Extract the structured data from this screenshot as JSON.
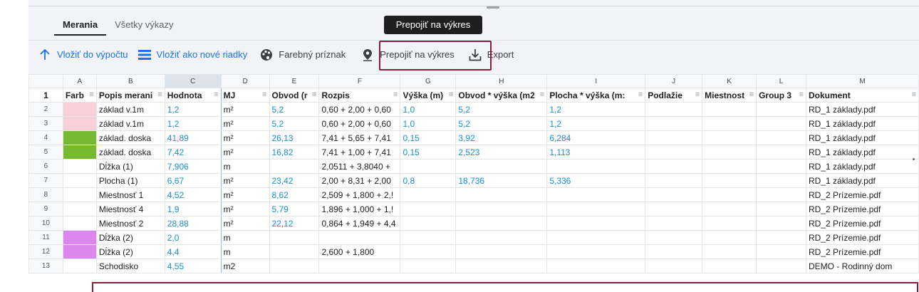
{
  "tabs": [
    "Merania",
    "Všetky výkazy"
  ],
  "tooltip": "Prepojiť na výkres",
  "toolbar": {
    "insert_calc": "Vložiť do výpočtu",
    "insert_rows": "Vložiť ako nové riadky",
    "color_flag": "Farebný príznak",
    "link_drawing": "Prepojiť na výkres",
    "export": "Export"
  },
  "colors": {
    "accent": "#1a73e8",
    "highlight": "#8e1b3b",
    "pink": "#f8d0da",
    "green": "#76b830",
    "violet": "#dc86f0"
  },
  "columns": [
    "A",
    "B",
    "C",
    "D",
    "E",
    "F",
    "G",
    "H",
    "I",
    "J",
    "K",
    "L",
    "M"
  ],
  "headers": [
    "Farb",
    "Popis merani",
    "Hodnota",
    "MJ",
    "Obvod (r",
    "Rozpis",
    "Výška (m)",
    "Obvod * výška (m2",
    "Plocha * výška (m:",
    "Podlažie",
    "Miestnost",
    "Group 3",
    "Dokument"
  ],
  "rows": [
    {
      "n": "2",
      "color": "pink",
      "popis": "základ v.1m",
      "hodnota": "1,2",
      "mj": "m²",
      "obvod": "5,2",
      "rozpis": "0,60 + 2,00 + 0,60",
      "vyska": "1,0",
      "ov": "5,2",
      "pv": "1,2",
      "dok": "RD_1 základy.pdf"
    },
    {
      "n": "3",
      "color": "pink",
      "popis": "základ v.1m",
      "hodnota": "1,2",
      "mj": "m²",
      "obvod": "5,2",
      "rozpis": "0,60 + 2,00 + 0,60",
      "vyska": "1,0",
      "ov": "5,2",
      "pv": "1,2",
      "dok": "RD_1 základy.pdf"
    },
    {
      "n": "4",
      "color": "green",
      "popis": "základ. doska",
      "hodnota": "41,89",
      "mj": "m²",
      "obvod": "26,13",
      "rozpis": "7,41 + 5,65 + 7,41",
      "vyska": "0,15",
      "ov": "3,92",
      "pv": "6,284",
      "dok": "RD_1 základy.pdf"
    },
    {
      "n": "5",
      "color": "green",
      "popis": "základ. doska",
      "hodnota": "7,42",
      "mj": "m²",
      "obvod": "16,82",
      "rozpis": "7,41 + 1,00 + 7,41",
      "vyska": "0,15",
      "ov": "2,523",
      "pv": "1,113",
      "dok": "RD_1 základy.pdf"
    },
    {
      "n": "6",
      "color": "",
      "popis": "Dĺžka (1)",
      "hodnota": "7,906",
      "mj": "m",
      "obvod": "",
      "rozpis": "2,0511 + 3,8040 +",
      "vyska": "",
      "ov": "",
      "pv": "",
      "dok": "RD_1 základy.pdf"
    },
    {
      "n": "7",
      "color": "",
      "popis": "Plocha (1)",
      "hodnota": "6,67",
      "mj": "m²",
      "obvod": "23,42",
      "rozpis": "2,00 + 8,31 + 2,00",
      "vyska": "0,8",
      "ov": "18,736",
      "pv": "5,336",
      "dok": "RD_1 základy.pdf"
    },
    {
      "n": "8",
      "color": "",
      "popis": "Miestnosť 1",
      "hodnota": "4,52",
      "mj": "m²",
      "obvod": "8,62",
      "rozpis": "2,509 + 1,800 + 2,!",
      "vyska": "",
      "ov": "",
      "pv": "",
      "dok": "RD_2 Prízemie.pdf"
    },
    {
      "n": "9",
      "color": "",
      "popis": "Miestnosť 4",
      "hodnota": "1,9",
      "mj": "m²",
      "obvod": "5,79",
      "rozpis": "1,896 + 1,000 + 1,!",
      "vyska": "",
      "ov": "",
      "pv": "",
      "dok": "RD_2 Prízemie.pdf"
    },
    {
      "n": "10",
      "color": "",
      "popis": "Miestnosť 2",
      "hodnota": "28,88",
      "mj": "m²",
      "obvod": "22,12",
      "rozpis": "0,864 + 1,949 + 4,4",
      "vyska": "",
      "ov": "",
      "pv": "",
      "dok": "RD_2 Prízemie.pdf"
    },
    {
      "n": "11",
      "color": "violet",
      "popis": "Dĺžka (2)",
      "hodnota": "2,0",
      "mj": "m",
      "obvod": "",
      "rozpis": "",
      "vyska": "",
      "ov": "",
      "pv": "",
      "dok": "RD_2 Prízemie.pdf"
    },
    {
      "n": "12",
      "color": "violet",
      "popis": "Dĺžka (2)",
      "hodnota": "4,4",
      "mj": "m",
      "obvod": "",
      "rozpis": "2,600 + 1,800",
      "vyska": "",
      "ov": "",
      "pv": "",
      "dok": "RD_2 Prízemie.pdf"
    },
    {
      "n": "13",
      "color": "",
      "popis": "Schodisko",
      "hodnota": "4,55",
      "mj": "m2",
      "obvod": "",
      "rozpis": "",
      "vyska": "",
      "ov": "",
      "pv": "",
      "dok": "DEMO - Rodinný dom"
    }
  ]
}
